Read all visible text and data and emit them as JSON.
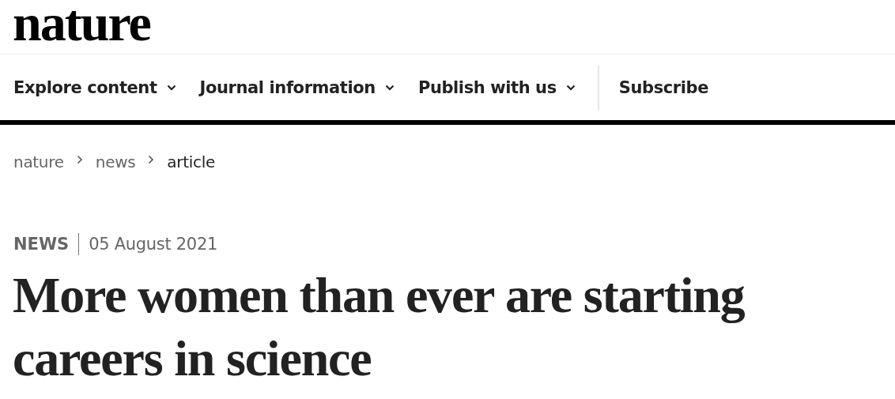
{
  "logo": "nature",
  "nav": [
    {
      "label": "Explore content",
      "kind": "menu"
    },
    {
      "label": "Journal information",
      "kind": "menu"
    },
    {
      "label": "Publish with us",
      "kind": "menu"
    },
    {
      "label": "Subscribe",
      "kind": "link"
    }
  ],
  "breadcrumb": [
    {
      "label": "nature",
      "selected": false
    },
    {
      "label": "news",
      "selected": false
    },
    {
      "label": "article",
      "selected": true
    }
  ],
  "article": {
    "type": "NEWS",
    "date": "05 August 2021",
    "title": "More women than ever are starting careers in science"
  }
}
